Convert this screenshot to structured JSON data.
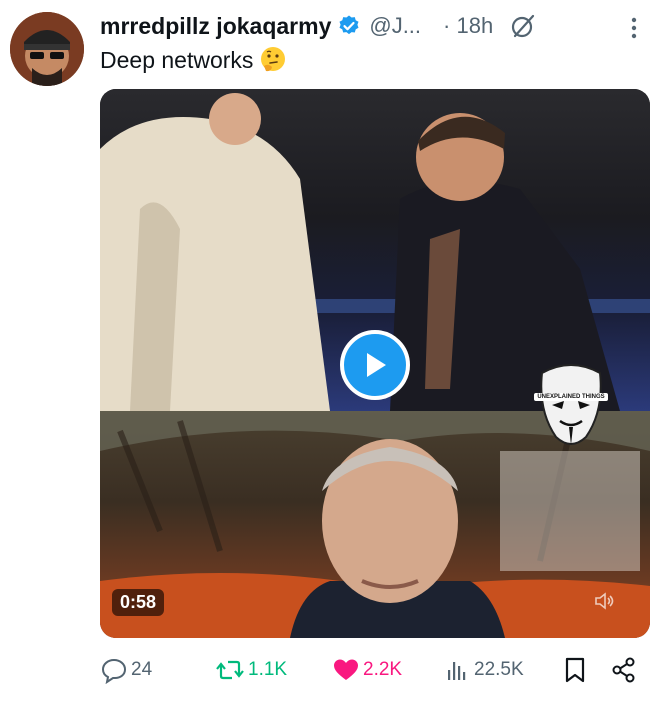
{
  "author": {
    "display_name": "mrredpillz jokaqarmy",
    "handle": "@J...",
    "time": "· 18h"
  },
  "tweet": {
    "text": "Deep networks"
  },
  "media": {
    "duration": "0:58",
    "watermark_text": "UNEXPLAINED THINGS"
  },
  "actions": {
    "replies": "24",
    "reposts": "1.1K",
    "likes": "2.2K",
    "views": "22.5K"
  },
  "colors": {
    "accent": "#1d9bf0",
    "repost": "#00ba7c",
    "like": "#f91880",
    "muted": "#536471"
  }
}
